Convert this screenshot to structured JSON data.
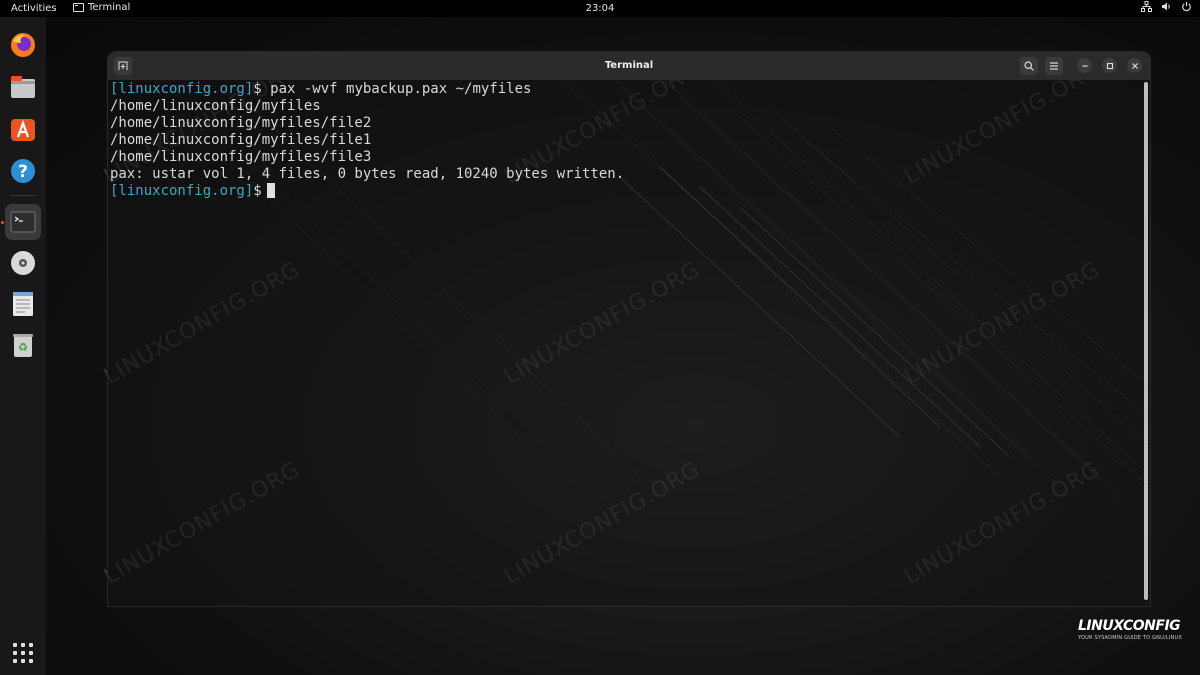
{
  "topbar": {
    "activities": "Activities",
    "app_name": "Terminal",
    "clock": "23:04",
    "tray_icons": [
      "network-icon",
      "volume-icon",
      "power-icon"
    ]
  },
  "dock": {
    "items": [
      {
        "name": "firefox",
        "icon": "firefox-icon"
      },
      {
        "name": "files",
        "icon": "files-icon"
      },
      {
        "name": "app-center",
        "icon": "app-center-icon"
      },
      {
        "name": "help",
        "icon": "help-icon"
      },
      {
        "name": "terminal",
        "icon": "terminal-icon",
        "active": true
      },
      {
        "name": "disc",
        "icon": "disc-icon"
      },
      {
        "name": "text-editor",
        "icon": "text-editor-icon"
      },
      {
        "name": "trash",
        "icon": "trash-icon"
      }
    ],
    "show_apps": "show-apps-icon"
  },
  "window": {
    "title": "Terminal"
  },
  "terminal": {
    "lines": [
      {
        "prompt": "[linuxconfig.org]",
        "text": "$ pax -wvf mybackup.pax ~/myfiles"
      },
      {
        "prompt": "",
        "text": "/home/linuxconfig/myfiles"
      },
      {
        "prompt": "",
        "text": "/home/linuxconfig/myfiles/file2"
      },
      {
        "prompt": "",
        "text": "/home/linuxconfig/myfiles/file1"
      },
      {
        "prompt": "",
        "text": "/home/linuxconfig/myfiles/file3"
      },
      {
        "prompt": "",
        "text": "pax: ustar vol 1, 4 files, 0 bytes read, 10240 bytes written."
      },
      {
        "prompt": "[linuxconfig.org]",
        "text": "$"
      }
    ]
  },
  "watermark": {
    "text": "LINUXCONFIG.ORG"
  },
  "brand": {
    "logo": "LINUXCONFIG",
    "tagline": "YOUR SYSADMIN GUIDE TO GNU/LINUX"
  },
  "colors": {
    "prompt": "#3aa7c9",
    "accent": "#e95420",
    "background": "#0e0e0e"
  }
}
